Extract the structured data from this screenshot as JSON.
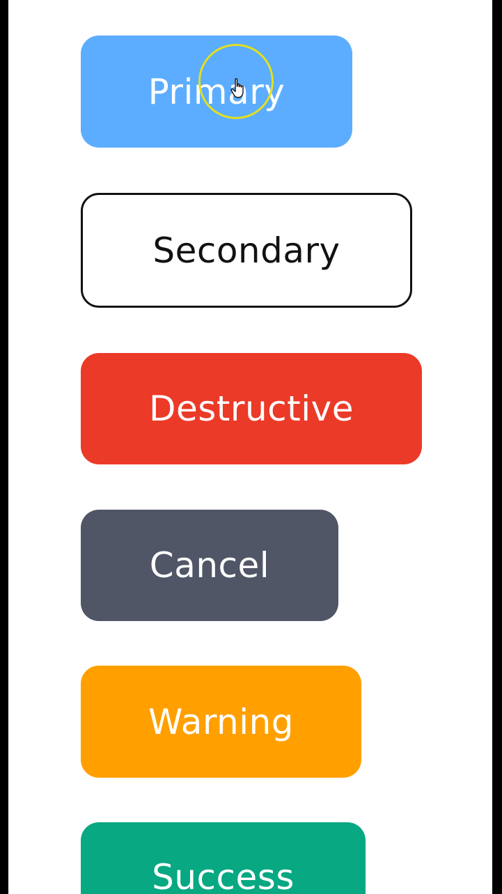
{
  "buttons": {
    "primary": {
      "label": "Primary",
      "color": "#5cadff"
    },
    "secondary": {
      "label": "Secondary",
      "color": "#ffffff",
      "border_color": "#111111"
    },
    "destructive": {
      "label": "Destructive",
      "color": "#ec3a28"
    },
    "cancel": {
      "label": "Cancel",
      "color": "#505666"
    },
    "warning": {
      "label": "Warning",
      "color": "#ffa000"
    },
    "success": {
      "label": "Success",
      "color": "#07a882"
    }
  },
  "cursor": {
    "icon": "hand-pointer-icon",
    "highlight_color": "#e2e01e"
  }
}
